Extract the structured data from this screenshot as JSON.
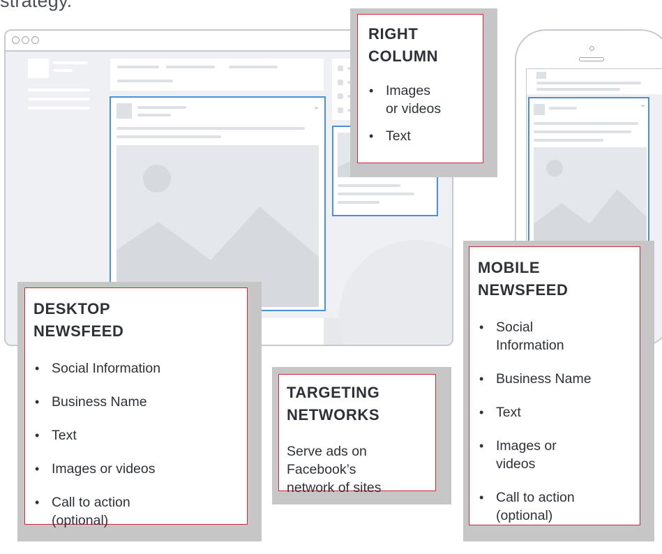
{
  "intro_text": "strategy.",
  "colors": {
    "callout_border": "#cc2a3a",
    "callout_shadow": "#c6c6c6",
    "highlight_blue": "#4a90d9",
    "mockup_outline": "#c5cad2",
    "mockup_fill": "#eef0f3"
  },
  "callouts": {
    "right_column": {
      "title_line1": "RIGHT",
      "title_line2": "COLUMN",
      "items": [
        {
          "line1": "Images",
          "line2": "or videos"
        },
        {
          "line1": "Text"
        }
      ]
    },
    "desktop_newsfeed": {
      "title_line1": "DESKTOP",
      "title_line2": "NEWSFEED",
      "items": [
        {
          "line1": "Social Information"
        },
        {
          "line1": "Business Name"
        },
        {
          "line1": "Text"
        },
        {
          "line1": "Images or videos"
        },
        {
          "line1": "Call to action",
          "line2": "(optional)"
        }
      ]
    },
    "targeting_networks": {
      "title_line1": "TARGETING",
      "title_line2": "NETWORKS",
      "body_line1": "Serve ads on",
      "body_line2": "Facebook’s",
      "body_line3": "network of sites"
    },
    "mobile_newsfeed": {
      "title_line1": "MOBILE",
      "title_line2": "NEWSFEED",
      "items": [
        {
          "line1": "Social",
          "line2": "Information"
        },
        {
          "line1": "Business Name"
        },
        {
          "line1": "Text"
        },
        {
          "line1": "Images or",
          "line2": "videos"
        },
        {
          "line1": "Call to action",
          "line2": "(optional)"
        }
      ]
    }
  }
}
